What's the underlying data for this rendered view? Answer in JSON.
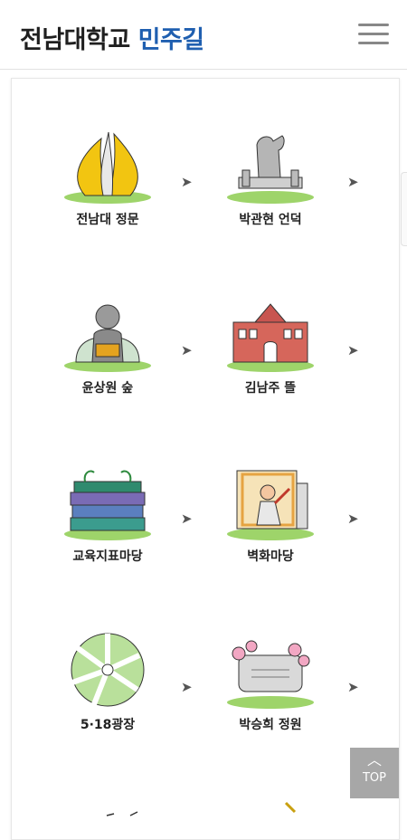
{
  "header": {
    "title_main": "전남대학교",
    "title_accent": "민주길",
    "menu_icon": "hamburger-menu-icon"
  },
  "colors": {
    "accent": "#1f5fb0",
    "top_button_bg": "#a7a7a7"
  },
  "places": [
    {
      "label": "전남대 정문",
      "icon": "main-gate-monument-icon"
    },
    {
      "label": "박관현 언덕",
      "icon": "memorial-statue-icon"
    },
    {
      "label": "윤상원 숲",
      "icon": "bust-statue-icon"
    },
    {
      "label": "김남주 뜰",
      "icon": "brick-building-icon"
    },
    {
      "label": "교육지표마당",
      "icon": "stacked-books-icon"
    },
    {
      "label": "벽화마당",
      "icon": "mural-icon"
    },
    {
      "label": "5·18광장",
      "icon": "plaza-map-icon"
    },
    {
      "label": "박승희 정원",
      "icon": "memorial-stone-garden-icon"
    }
  ],
  "arrow_glyph": "➤",
  "top_button": {
    "label": "TOP",
    "icon": "chevron-up-icon"
  }
}
